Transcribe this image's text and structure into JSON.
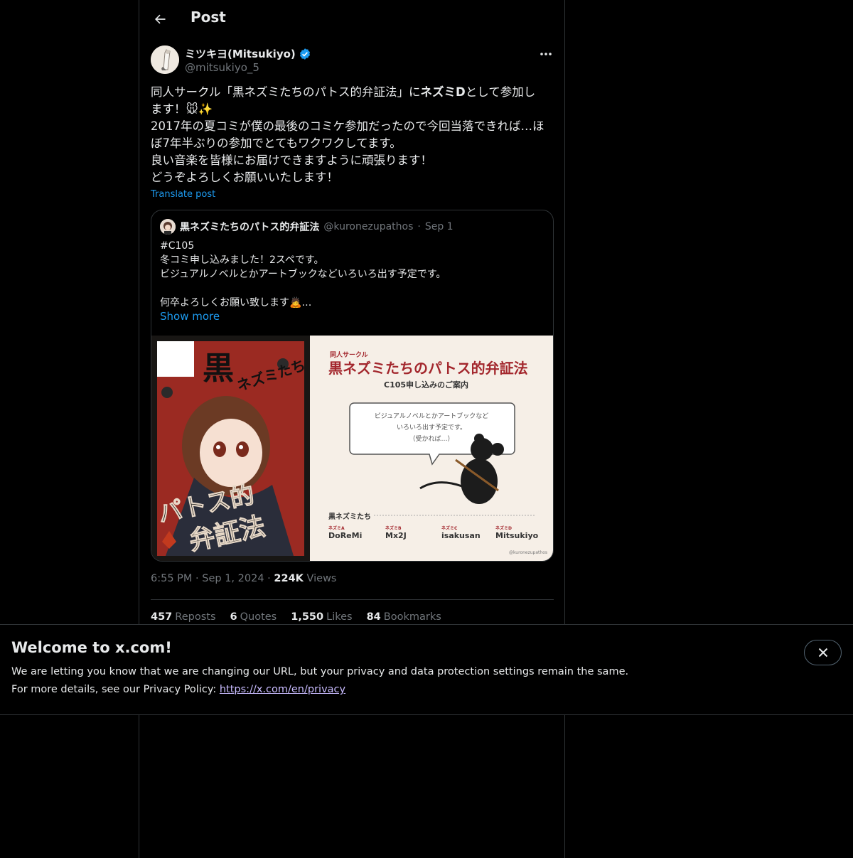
{
  "header": {
    "title": "Post"
  },
  "post": {
    "display_name": "ミツキヨ(Mitsukiyo)",
    "handle": "@mitsukiyo_5",
    "text_lines": [
      {
        "before": "同人サークル「黒ネズミたちのパトス的弁証法」に",
        "bold": "ネズミD",
        "after": "として参加し"
      },
      {
        "before": "ます！🐭✨",
        "bold": "",
        "after": ""
      },
      {
        "before": "2017年の夏コミが僕の最後のコミケ参加だったので今回当落できれば…ほ",
        "bold": "",
        "after": ""
      },
      {
        "before": "ぼ7年半ぶりの参加でとてもワクワクしてます。",
        "bold": "",
        "after": ""
      },
      {
        "before": "良い音楽を皆様にお届けできますように頑張ります！",
        "bold": "",
        "after": ""
      },
      {
        "before": "どうぞよろしくお願いいたします！",
        "bold": "",
        "after": ""
      }
    ],
    "translate_label": "Translate post",
    "time": "6:55 PM",
    "date": "Sep 1, 2024",
    "views_count": "224K",
    "views_label": "Views",
    "sep": "·"
  },
  "quote": {
    "name": "黒ネズミたちのパトス的弁証法",
    "handle": "@kuronezupathos",
    "dot": "·",
    "date": "Sep 1",
    "text": "#C105\n冬コミ申し込みました！2スペです。\nビジュアルノベルとかアートブックなどいろいろ出す予定です。\n\n何卒よろしくお願い致します🙇…",
    "show_more": "Show more",
    "image1": {
      "title_top": "黒",
      "title_side": "ネズミたち",
      "title_bottom": "パトス的",
      "title_bottom2": "弁証法"
    },
    "image2": {
      "kicker": "同人サークル",
      "title": "黒ネズミたちのパトス的弁証法",
      "subtitle": "C105申し込みのご案内",
      "bubble": "ビジュアルノベルとかアートブックなど\nいろいろ出す予定です。\n（受かれば…）",
      "members_label": "黒ネズミたち",
      "members": [
        {
          "role": "ネズミA",
          "name": "DoReMi"
        },
        {
          "role": "ネズミB",
          "name": "Mx2J"
        },
        {
          "role": "ネズミC",
          "name": "isakusan"
        },
        {
          "role": "ネズミD",
          "name": "Mitsukiyo"
        }
      ],
      "credit": "@kuronezupathos"
    }
  },
  "stats": [
    {
      "count": "457",
      "label": "Reposts"
    },
    {
      "count": "6",
      "label": "Quotes"
    },
    {
      "count": "1,550",
      "label": "Likes"
    },
    {
      "count": "84",
      "label": "Bookmarks"
    }
  ],
  "banner": {
    "title": "Welcome to x.com!",
    "line1": "We are letting you know that we are changing our URL, but your privacy and data protection settings remain the same.",
    "line2_prefix": "For more details, see our Privacy Policy: ",
    "link": "https://x.com/en/privacy"
  },
  "icons": {
    "back": "arrow-left-icon",
    "more": "more-horizontal-icon",
    "verified": "verified-badge-icon",
    "close": "close-icon"
  },
  "colors": {
    "accent": "#1d9bf0",
    "muted": "#71767b",
    "border": "#2f3336",
    "link": "#c9bcff"
  }
}
